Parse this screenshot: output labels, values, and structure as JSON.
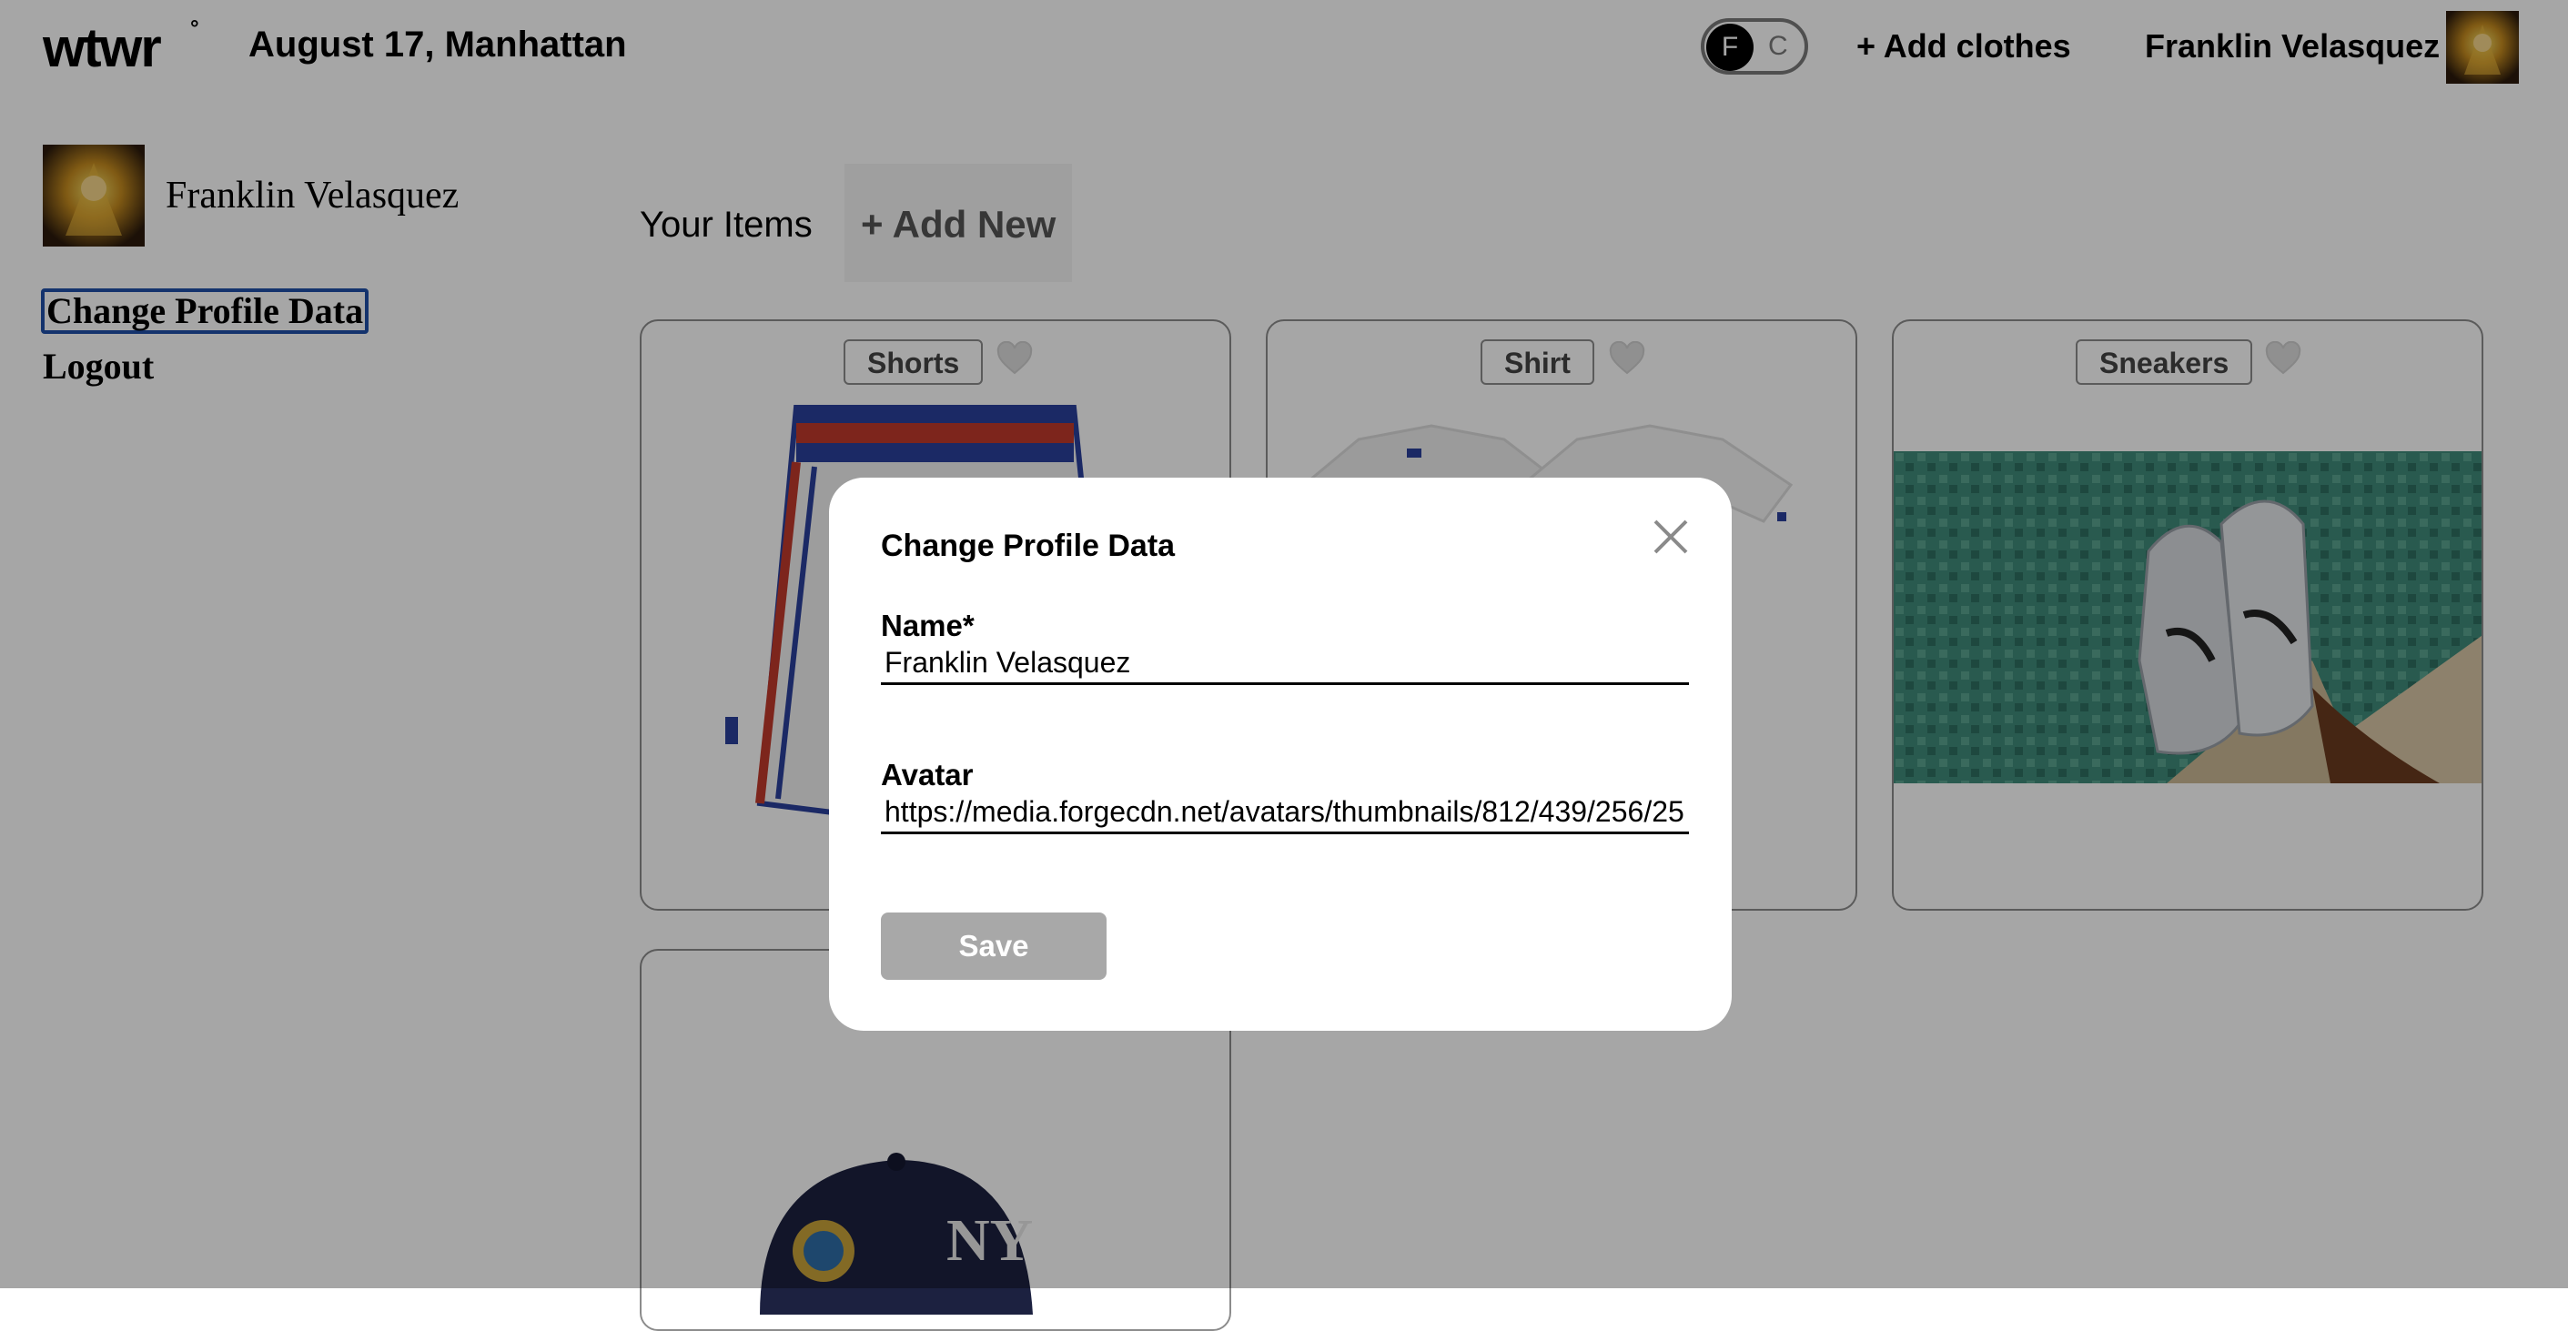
{
  "header": {
    "logo": "wtwr",
    "logo_mark": "°",
    "date_location": "August 17, Manhattan",
    "toggle": {
      "on_label": "F",
      "off_label": "C",
      "selected": "F"
    },
    "add_clothes": "+ Add clothes",
    "user_name": "Franklin Velasquez"
  },
  "sidebar": {
    "user_name": "Franklin Velasquez",
    "change_profile": "Change Profile Data",
    "logout": "Logout"
  },
  "items_section": {
    "title": "Your Items",
    "add_new": "+ Add New"
  },
  "cards": [
    {
      "label": "Shorts",
      "icon": "heart-icon"
    },
    {
      "label": "Shirt",
      "icon": "heart-icon"
    },
    {
      "label": "Sneakers",
      "icon": "heart-icon"
    },
    {
      "label": "",
      "icon": ""
    }
  ],
  "modal": {
    "title": "Change Profile Data",
    "name_label": "Name*",
    "name_value": "Franklin Velasquez",
    "avatar_label": "Avatar",
    "avatar_value": "https://media.forgecdn.net/avatars/thumbnails/812/439/256/25",
    "save_label": "Save",
    "close_icon": "close-icon"
  },
  "colors": {
    "overlay": "#000000",
    "save_disabled": "#a8a8a8",
    "focus_outline": "#1f4fa8",
    "card_border": "#8c8c8c"
  }
}
